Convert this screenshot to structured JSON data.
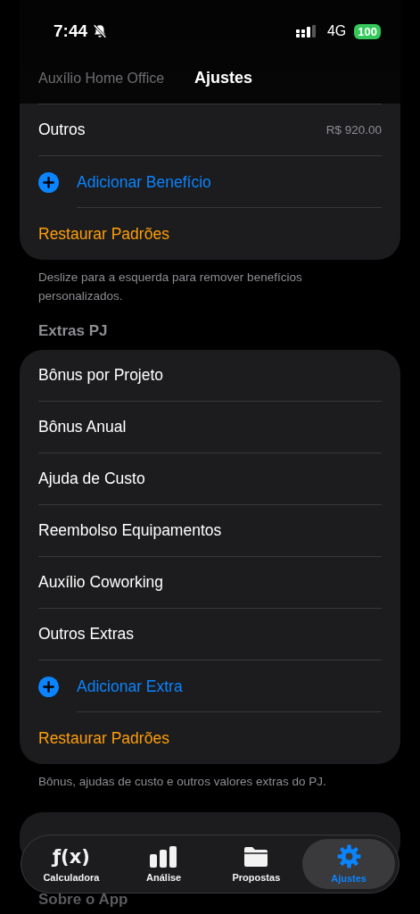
{
  "status_bar": {
    "time": "7:44",
    "network": "4G",
    "battery": "100"
  },
  "nav": {
    "title": "Ajustes"
  },
  "benefits": {
    "rows": [
      {
        "kind": "faded",
        "label": "Auxílio Home Office"
      },
      {
        "kind": "value",
        "label": "Outros",
        "value": "R$ 920.00"
      },
      {
        "kind": "add",
        "label": "Adicionar Benefício"
      },
      {
        "kind": "restore",
        "label": "Restaurar Padrões"
      }
    ],
    "footer": "Deslize para a esquerda para remover benefícios personalizados."
  },
  "extras": {
    "header": "Extras PJ",
    "rows": [
      {
        "kind": "plain",
        "label": "Bônus por Projeto"
      },
      {
        "kind": "plain",
        "label": "Bônus Anual"
      },
      {
        "kind": "plain",
        "label": "Ajuda de Custo"
      },
      {
        "kind": "plain",
        "label": "Reembolso Equipamentos"
      },
      {
        "kind": "plain",
        "label": "Auxílio Coworking"
      },
      {
        "kind": "plain",
        "label": "Outros Extras"
      },
      {
        "kind": "add",
        "label": "Adicionar Extra"
      },
      {
        "kind": "restore",
        "label": "Restaurar Padrões"
      }
    ],
    "footer": "Bônus, ajudas de custo e outros valores extras do PJ."
  },
  "next_section": {
    "header": "Sobre o App"
  },
  "tab_bar": [
    {
      "symbol": "ƒ(x)",
      "label": "Calculadora",
      "selected": false
    },
    {
      "label": "Análise",
      "selected": false
    },
    {
      "label": "Propostas",
      "selected": false
    },
    {
      "label": "Ajustes",
      "selected": true
    }
  ]
}
